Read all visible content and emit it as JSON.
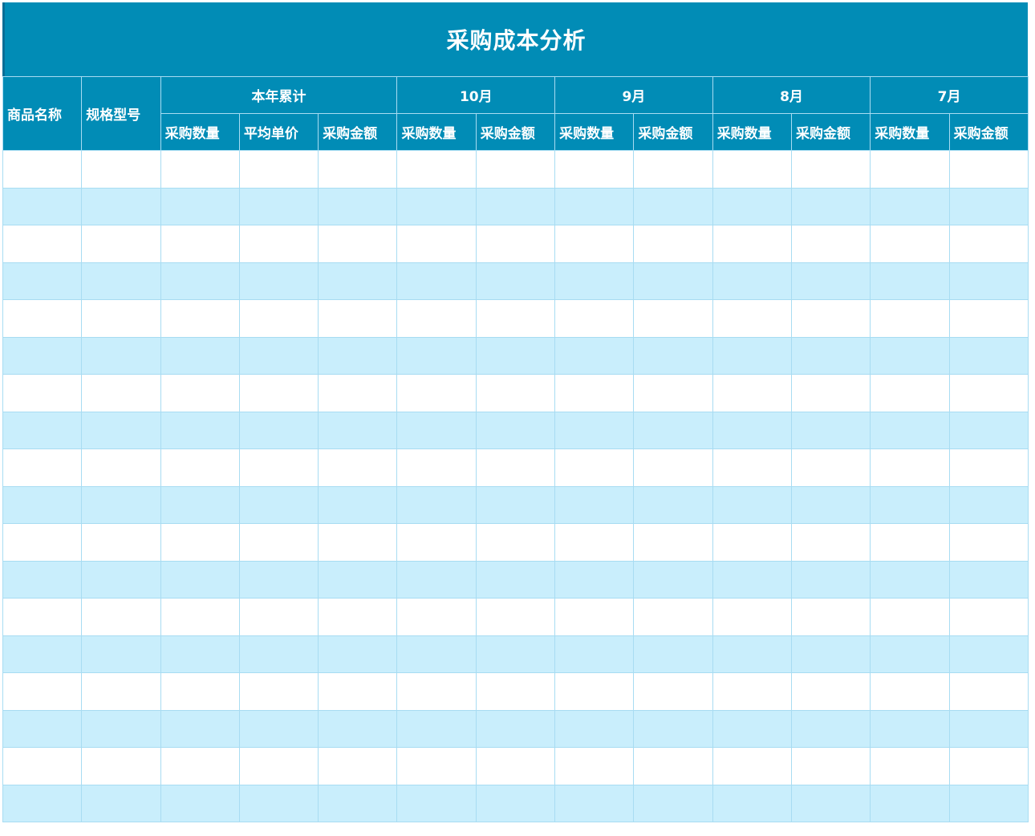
{
  "title": "采购成本分析",
  "header": {
    "fixed_columns": [
      "商品名称",
      "规格型号"
    ],
    "groups": [
      {
        "label": "本年累计",
        "subcolumns": [
          "采购数量",
          "平均单价",
          "采购金额"
        ]
      },
      {
        "label": "10月",
        "subcolumns": [
          "采购数量",
          "采购金额"
        ]
      },
      {
        "label": "9月",
        "subcolumns": [
          "采购数量",
          "采购金额"
        ]
      },
      {
        "label": "8月",
        "subcolumns": [
          "采购数量",
          "采购金额"
        ]
      },
      {
        "label": "7月",
        "subcolumns": [
          "采购数量",
          "采购金额"
        ]
      }
    ]
  },
  "body": {
    "row_count": 18,
    "column_count": 13
  },
  "colors": {
    "header_bg": "#018cb6",
    "band_blue": "#c9eefc",
    "band_white": "#ffffff",
    "grid": "#a8dcf2"
  }
}
